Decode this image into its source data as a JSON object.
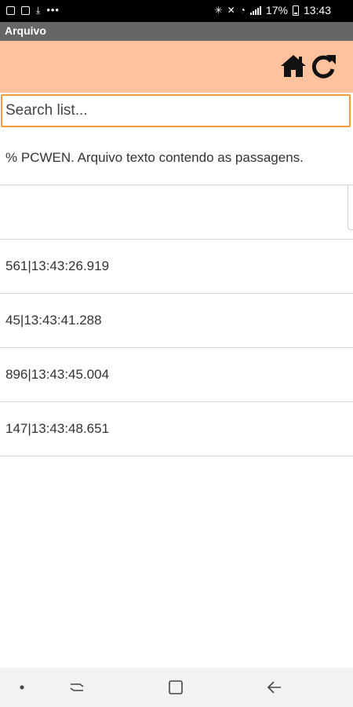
{
  "status_bar": {
    "battery": "17%",
    "time": "13:43"
  },
  "app": {
    "title": "Arquivo"
  },
  "toolbar": {
    "home_icon": "home-icon",
    "refresh_icon": "refresh-icon",
    "background": "#ffc29d"
  },
  "search": {
    "placeholder": "Search list...",
    "value": ""
  },
  "list": {
    "items": [
      {
        "text": "% PCWEN. Arquivo texto contendo as passagens."
      },
      {
        "text": ""
      },
      {
        "text": "561|13:43:26.919"
      },
      {
        "text": "45|13:43:41.288"
      },
      {
        "text": "896|13:43:45.004"
      },
      {
        "text": "147|13:43:48.651"
      }
    ]
  },
  "nav_bar": {
    "icons": [
      "dot-icon",
      "recent-apps-icon",
      "home-square-icon",
      "back-arrow-icon"
    ]
  }
}
